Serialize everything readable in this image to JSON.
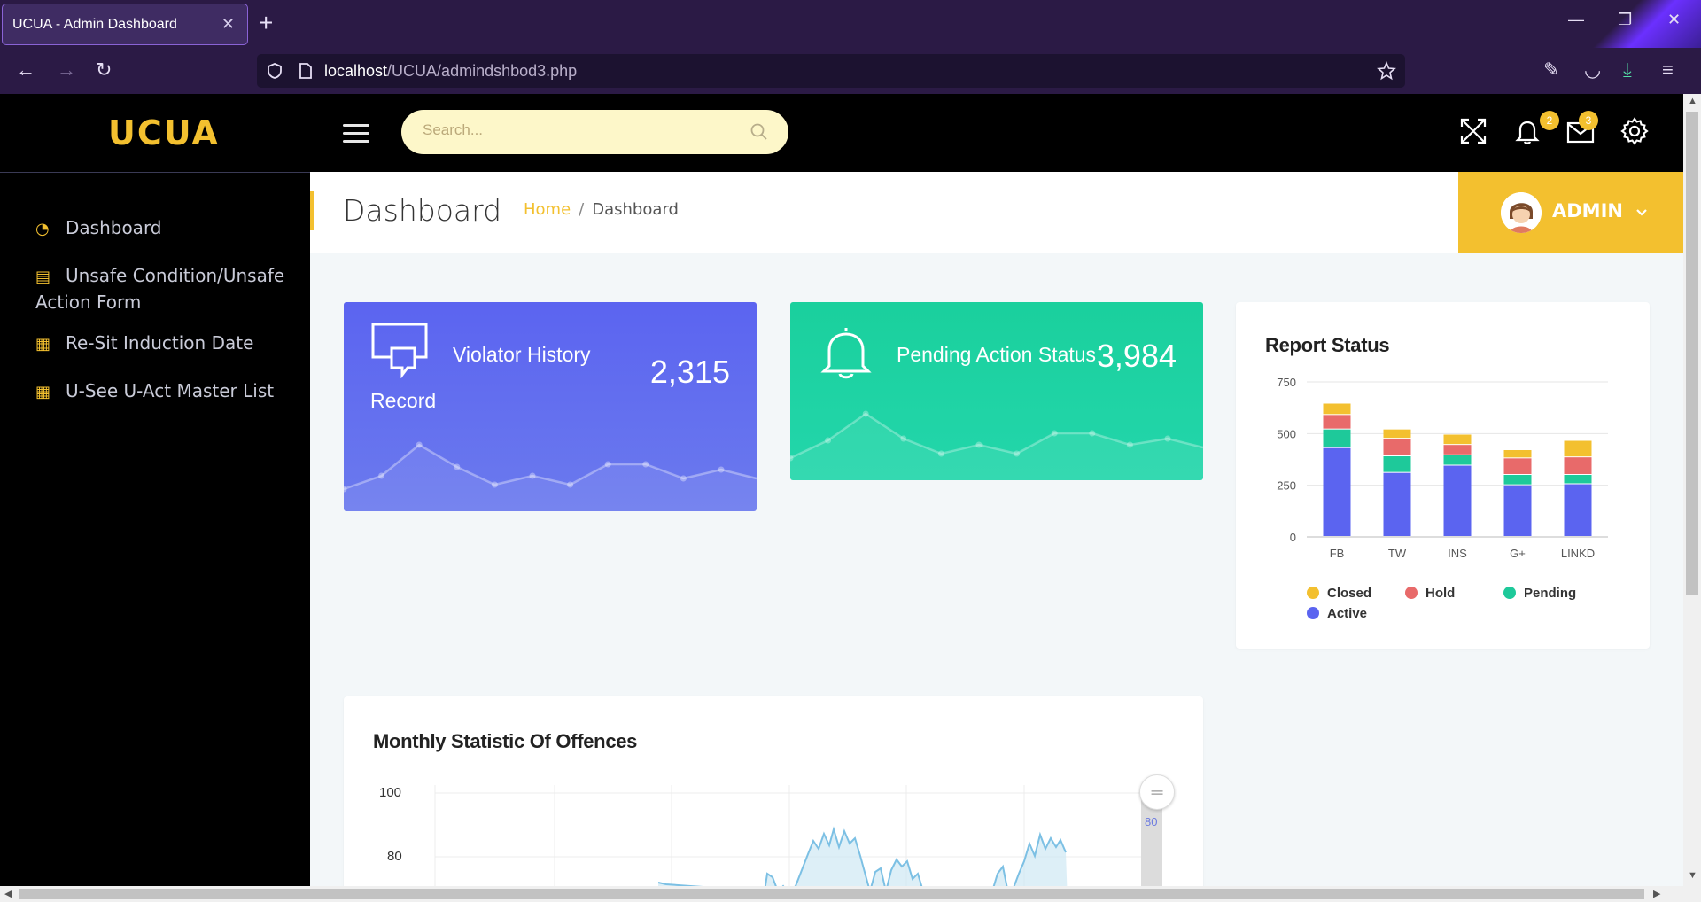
{
  "browser": {
    "tab_title": "UCUA - Admin Dashboard",
    "tab_close": "✕",
    "new_tab": "+",
    "url_host": "localhost",
    "url_path": "/UCUA/admindshbod3.php"
  },
  "app": {
    "logo": "UCUA",
    "search_placeholder": "Search...",
    "notifications_count": "2",
    "messages_count": "3"
  },
  "sidebar": {
    "items": [
      {
        "label": "Dashboard"
      },
      {
        "label": "Unsafe Condition/Unsafe Action Form"
      },
      {
        "label": "Re-Sit Induction Date"
      },
      {
        "label": "U-See U-Act Master List"
      }
    ]
  },
  "header": {
    "title": "Dashboard",
    "breadcrumb_home": "Home",
    "breadcrumb_sep": "/",
    "breadcrumb_current": "Dashboard",
    "user": "ADMIN"
  },
  "cards": {
    "violator": {
      "title": "Violator History",
      "subtitle": "Record",
      "value": "2,315"
    },
    "pending": {
      "title": "Pending Action Status",
      "value": "3,984"
    }
  },
  "report": {
    "title": "Report Status",
    "colors": {
      "Closed": "#f3c02f",
      "Hold": "#e86a6a",
      "Pending": "#1ec99a",
      "Active": "#5b64f0"
    }
  },
  "monthly": {
    "title": "Monthly Statistic Of Offences",
    "slider_label": "80",
    "y_ticks": [
      "100",
      "80"
    ]
  },
  "chart_data": [
    {
      "type": "bar",
      "title": "Report Status",
      "categories": [
        "FB",
        "TW",
        "INS",
        "G+",
        "LINKD"
      ],
      "ylim": [
        0,
        750
      ],
      "y_ticks": [
        0,
        250,
        500,
        750
      ],
      "stacked": true,
      "series": [
        {
          "name": "Active",
          "values": [
            430,
            310,
            345,
            250,
            255
          ]
        },
        {
          "name": "Pending",
          "values": [
            90,
            80,
            50,
            50,
            45
          ]
        },
        {
          "name": "Hold",
          "values": [
            70,
            85,
            50,
            80,
            85
          ]
        },
        {
          "name": "Closed",
          "values": [
            55,
            45,
            50,
            40,
            80
          ]
        }
      ],
      "legend": "bottom",
      "grid": true
    },
    {
      "type": "line",
      "title": "Violator History",
      "values": [
        10,
        25,
        60,
        35,
        15,
        25,
        15,
        38,
        38,
        22,
        32
      ]
    },
    {
      "type": "line",
      "title": "Pending Action Status",
      "values": [
        10,
        30,
        60,
        32,
        15,
        25,
        15,
        38,
        38,
        25,
        32
      ]
    }
  ]
}
